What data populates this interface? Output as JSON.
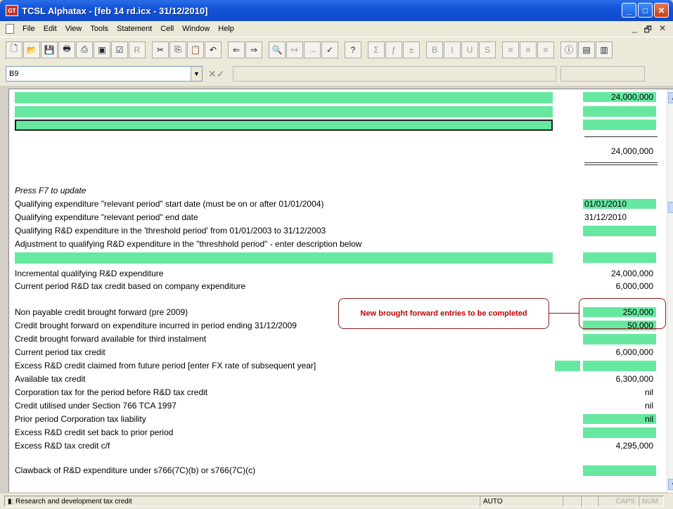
{
  "window": {
    "title": "TCSL Alphatax - [feb 14 rd.icx - 31/12/2010]",
    "app_icon_text": "GT"
  },
  "menu": [
    "File",
    "Edit",
    "View",
    "Tools",
    "Statement",
    "Cell",
    "Window",
    "Help"
  ],
  "formula_bar": {
    "cell_ref": "B9"
  },
  "sheet": {
    "top_value": "24,000,000",
    "total_value": "24,000,000",
    "press_f7": "Press F7 to update",
    "rows": [
      {
        "label": "Qualifying expenditure \"relevant period\" start date (must be on or after 01/01/2004)",
        "value": "01/01/2010"
      },
      {
        "label": "Qualifying expenditure \"relevant period\" end date",
        "value": "31/12/2010"
      },
      {
        "label": "Qualifying R&D expenditure in the 'threshold period' from 01/01/2003 to 31/12/2003",
        "value": ""
      },
      {
        "label": "Adjustment to qualifying R&D expenditure in the \"threshhold period\" - enter description below",
        "value": ""
      },
      {
        "label": "Incremental qualifying R&D expenditure",
        "value": "24,000,000"
      },
      {
        "label": "Current period R&D tax credit based on company expenditure",
        "value": "6,000,000"
      },
      {
        "label": "Non payable credit brought forward (pre 2009)",
        "value": "250,000"
      },
      {
        "label": "Credit brought forward on expenditure incurred in period ending 31/12/2009",
        "value": "50,000"
      },
      {
        "label": "Credit brought forward available for third instalment",
        "value": ""
      },
      {
        "label": "Current period tax credit",
        "value": "6,000,000"
      },
      {
        "label": "Excess R&D credit claimed from future period [enter FX rate of subsequent year]",
        "value": ""
      },
      {
        "label": "Available tax credit",
        "value": "6,300,000"
      },
      {
        "label": "Corporation tax for the period before R&D tax credit",
        "value": "nil"
      },
      {
        "label": "Credit utilised under Section 766 TCA 1997",
        "value": "nil"
      },
      {
        "label": "Prior period Corporation tax liability",
        "value": "nil"
      },
      {
        "label": "Excess R&D credit set back to prior period",
        "value": ""
      },
      {
        "label": "Excess R&D tax credit c/f",
        "value": "4,295,000"
      },
      {
        "label": "Clawback of R&D expenditure under s766(7C)(b) or s766(7C)(c)",
        "value": ""
      }
    ],
    "callout": "New brought forward entries to be completed"
  },
  "status": {
    "description": "▮: Research and development tax credit",
    "mode": "AUTO",
    "caps": "CAPS",
    "num": "NUM"
  }
}
